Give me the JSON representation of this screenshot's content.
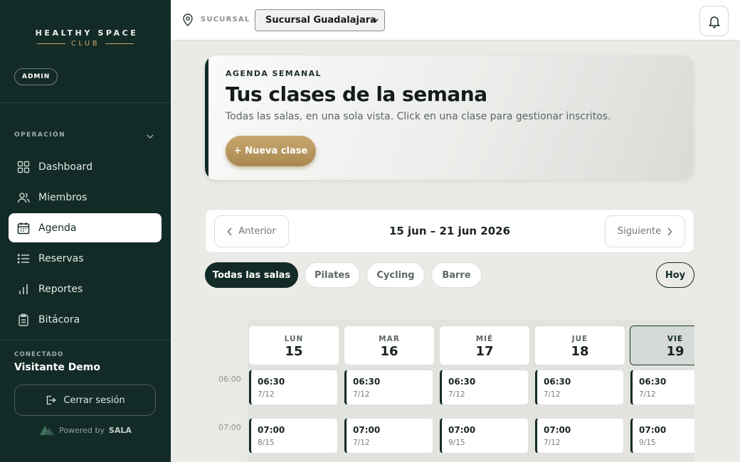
{
  "brand": {
    "name_top": "HEALTHY SPACE",
    "name_bottom": "CLUB",
    "role_badge": "ADMIN",
    "accent": "#c6a56c",
    "sidebar_bg": "#132b26"
  },
  "sidebar": {
    "section_title": "OPERACIÓN",
    "items": [
      {
        "label": "Dashboard",
        "icon": "grid-icon"
      },
      {
        "label": "Miembros",
        "icon": "users-icon"
      },
      {
        "label": "Agenda",
        "icon": "calendar-icon",
        "active": true
      },
      {
        "label": "Reservas",
        "icon": "list-icon"
      },
      {
        "label": "Reportes",
        "icon": "bar-chart-icon"
      },
      {
        "label": "Bitácora",
        "icon": "clipboard-icon"
      }
    ],
    "connected_label": "CONECTADO",
    "user_name": "Visitante Demo",
    "logout_label": "Cerrar sesión",
    "powered_prefix": "Powered by",
    "powered_brand": "SALA"
  },
  "topbar": {
    "branch_label": "SUCURSAL",
    "branch_value": "Sucursal Guadalajara"
  },
  "hero": {
    "eyebrow": "AGENDA SEMANAL",
    "title": "Tus clases de la semana",
    "description": "Todas las salas, en una sola vista. Click en una clase para gestionar inscritos.",
    "new_class_label": "+ Nueva clase"
  },
  "week": {
    "prev_label": "Anterior",
    "range": "15 jun – 21 jun 2026",
    "next_label": "Siguiente"
  },
  "filters": {
    "rooms": [
      "Todas las salas",
      "Pilates",
      "Cycling",
      "Barre"
    ],
    "active_index": 0,
    "today_label": "Hoy"
  },
  "calendar": {
    "days": [
      {
        "name": "LUN",
        "num": "15"
      },
      {
        "name": "MAR",
        "num": "16"
      },
      {
        "name": "MIÉ",
        "num": "17"
      },
      {
        "name": "JUE",
        "num": "18"
      },
      {
        "name": "VIE",
        "num": "19",
        "today": true
      }
    ],
    "times": [
      "06:00",
      "07:00"
    ],
    "rows": [
      [
        {
          "time": "06:30",
          "cap": "7/12"
        },
        {
          "time": "06:30",
          "cap": "7/12"
        },
        {
          "time": "06:30",
          "cap": "7/12"
        },
        {
          "time": "06:30",
          "cap": "7/12"
        },
        {
          "time": "06:30",
          "cap": "7/12"
        }
      ],
      [
        {
          "time": "07:00",
          "cap": "8/15"
        },
        {
          "time": "07:00",
          "cap": "7/12"
        },
        {
          "time": "07:00",
          "cap": "9/15"
        },
        {
          "time": "07:00",
          "cap": "7/12"
        },
        {
          "time": "07:00",
          "cap": "9/15"
        }
      ]
    ]
  }
}
